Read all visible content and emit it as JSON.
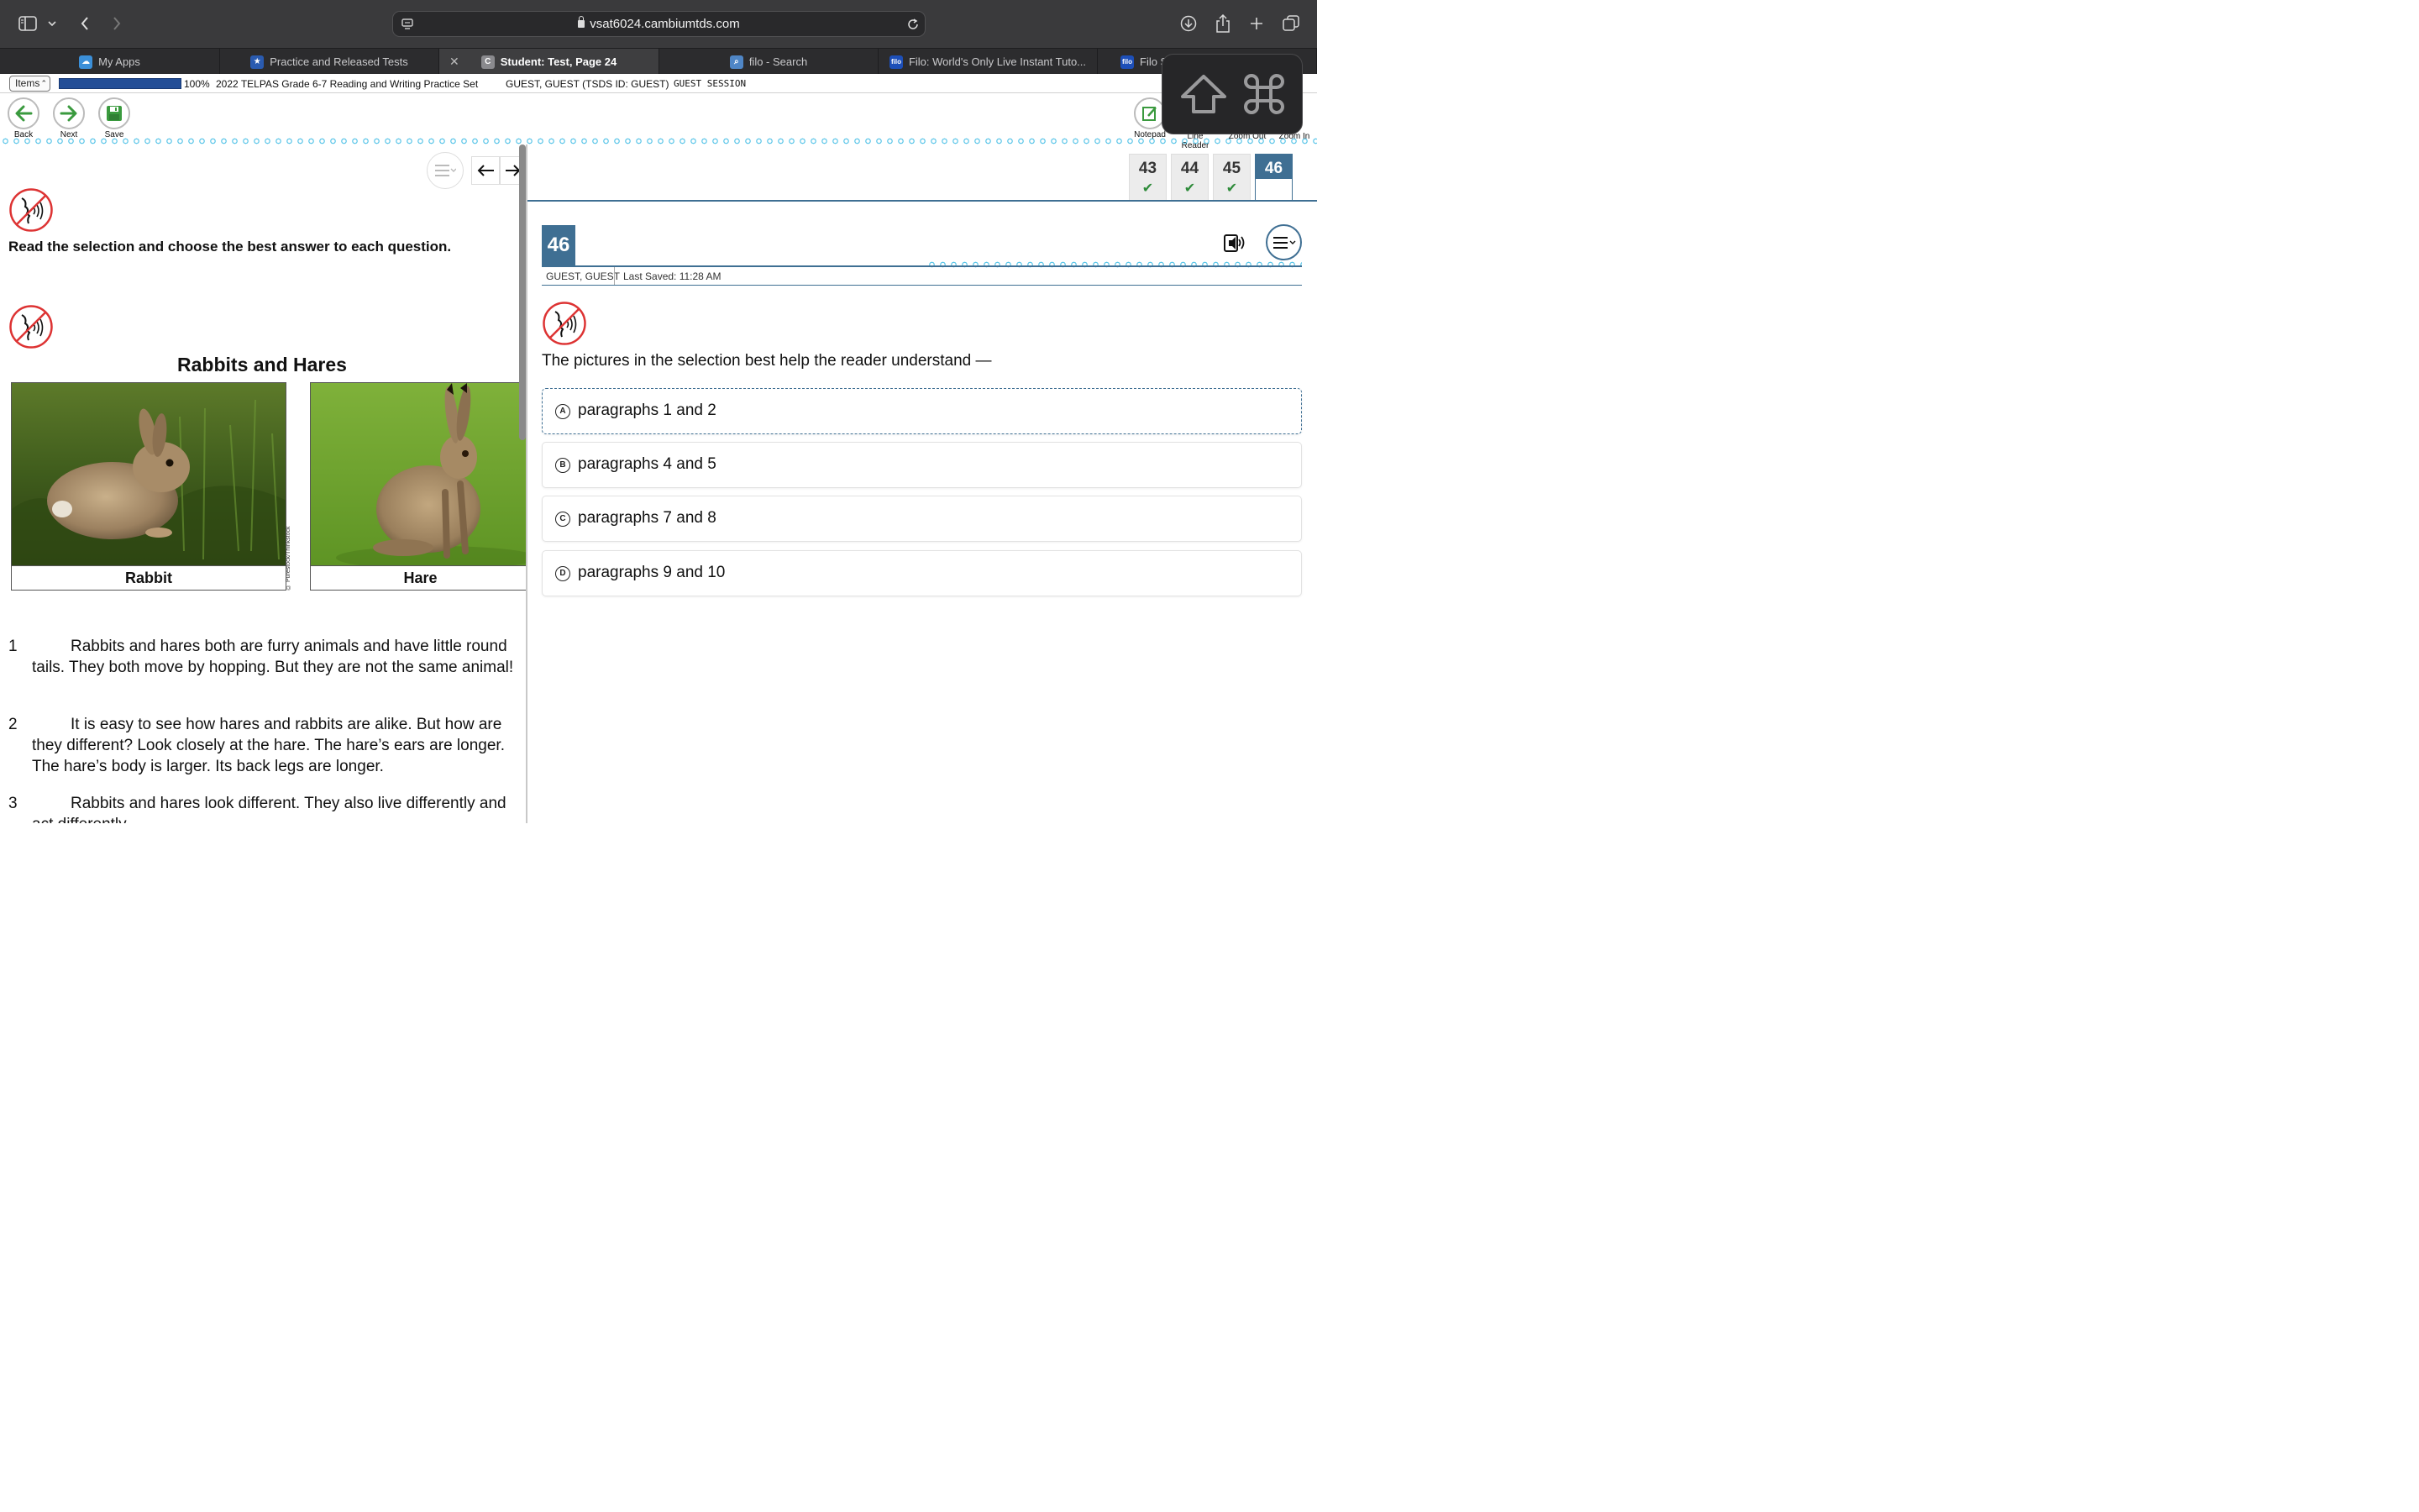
{
  "browser": {
    "url": "vsat6024.cambiumtds.com",
    "tabs": [
      {
        "label": "My Apps",
        "favicon": "cloud-icon"
      },
      {
        "label": "Practice and Released Tests",
        "favicon": "star-icon"
      },
      {
        "label": "Student: Test, Page 24",
        "favicon": "c-icon",
        "active": true
      },
      {
        "label": "filo - Search",
        "favicon": "search-icon"
      },
      {
        "label": "Filo: World's Only Live Instant Tuto...",
        "favicon": "filo-icon"
      },
      {
        "label": "Filo S",
        "favicon": "filo-icon"
      }
    ]
  },
  "infostrip": {
    "items_select": "Items",
    "progress_label": "100%",
    "test_name": "2022 TELPAS Grade 6-7 Reading and Writing Practice Set",
    "student": "GUEST, GUEST (TSDS ID: GUEST)",
    "session": "GUEST SESSION"
  },
  "toolbar": {
    "back": "Back",
    "next": "Next",
    "save": "Save",
    "notepad": "Notepad",
    "line_reader": "Line Reader",
    "zoom_out": "Zoom Out",
    "zoom_in": "Zoom In"
  },
  "passage": {
    "instruction": "Read the selection and choose the best answer to each question.",
    "title": "Rabbits and Hares",
    "photo1_caption": "Rabbit",
    "photo2_caption": "Hare",
    "credit": "© Purestock/Thinkstock",
    "paragraphs": [
      {
        "num": "1",
        "text": "Rabbits and hares both are furry animals and have little round tails. They both move by hopping. But they are not the same animal!"
      },
      {
        "num": "2",
        "text": "It is easy to see how hares and rabbits are alike. But how are they different? Look closely at the hare. The hare’s ears are longer. The hare’s body is larger. Its back legs are longer."
      },
      {
        "num": "3",
        "text": "Rabbits and hares look different. They also live differently and act differently."
      }
    ]
  },
  "question_nav": [
    {
      "num": "43",
      "answered": true
    },
    {
      "num": "44",
      "answered": true
    },
    {
      "num": "45",
      "answered": true
    },
    {
      "num": "46",
      "answered": false,
      "current": true
    }
  ],
  "question": {
    "number": "46",
    "student": "GUEST, GUEST",
    "last_saved": "Last Saved: 11:28 AM",
    "stem": "The pictures in the selection best help the reader understand —",
    "options": [
      {
        "letter": "A",
        "text": "paragraphs 1 and 2"
      },
      {
        "letter": "B",
        "text": "paragraphs 4 and 5"
      },
      {
        "letter": "C",
        "text": "paragraphs 7 and 8"
      },
      {
        "letter": "D",
        "text": "paragraphs 9 and 10"
      }
    ]
  },
  "colors": {
    "accent": "#3f6f93",
    "progress": "#234e97",
    "check": "#2e8b3a",
    "dots": "#5fc7e9"
  }
}
